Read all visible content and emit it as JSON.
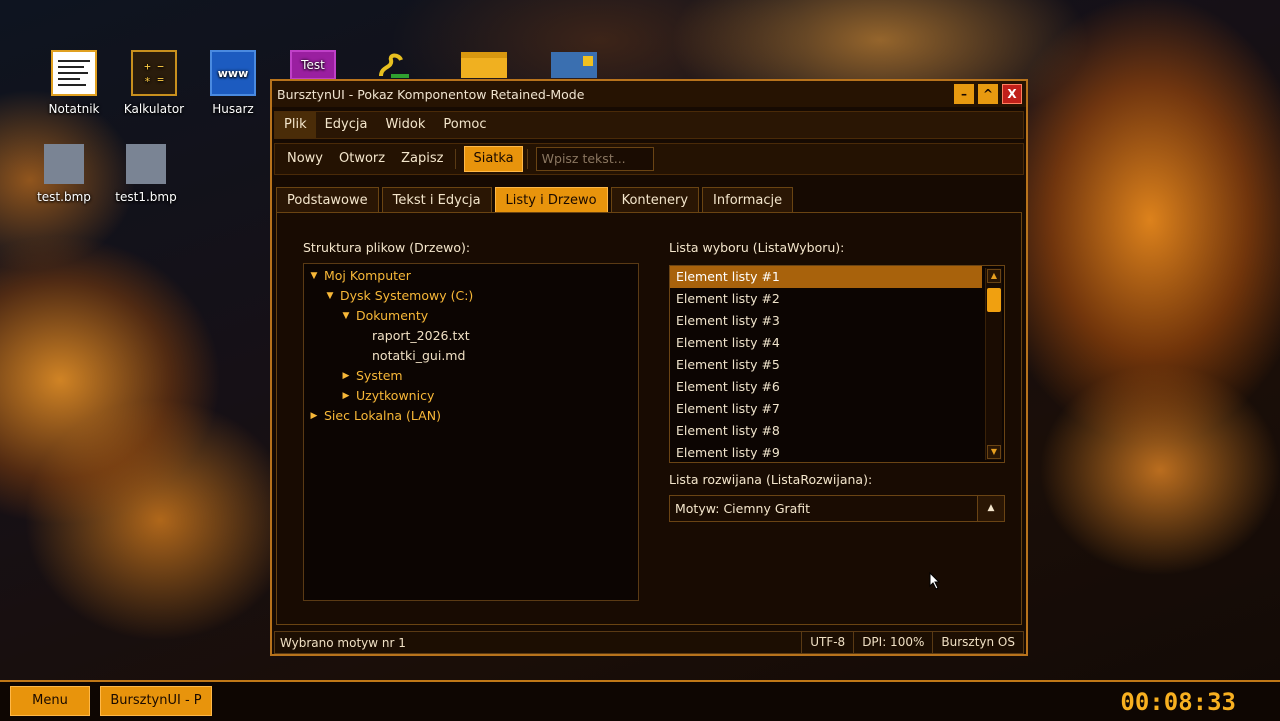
{
  "desktop": {
    "icons": [
      {
        "label": "Notatnik",
        "icon": "notepad-icon"
      },
      {
        "label": "Kalkulator",
        "icon": "calculator-icon",
        "glyph": "+ −\n∗ ="
      },
      {
        "label": "Husarz",
        "icon": "browser-icon",
        "glyph": "www"
      },
      {
        "label": "",
        "icon": "test-app-icon",
        "glyph": "Test"
      },
      {
        "label": "",
        "icon": "snake-icon"
      },
      {
        "label": "",
        "icon": "folder-icon"
      },
      {
        "label": "",
        "icon": "image-icon"
      },
      {
        "label": "test.bmp",
        "icon": "bmp-file-icon"
      },
      {
        "label": "test1.bmp",
        "icon": "bmp-file-icon"
      }
    ]
  },
  "window": {
    "title": "BursztynUI - Pokaz Komponentow Retained-Mode",
    "controls": {
      "minimize": "–",
      "maximize": "^",
      "close": "X"
    },
    "menu": [
      "Plik",
      "Edycja",
      "Widok",
      "Pomoc"
    ],
    "toolbar": {
      "buttons": [
        "Nowy",
        "Otworz",
        "Zapisz"
      ],
      "toggle": "Siatka",
      "input_placeholder": "Wpisz tekst..."
    },
    "tabs": [
      "Podstawowe",
      "Tekst i Edycja",
      "Listy i Drzewo",
      "Kontenery",
      "Informacje"
    ],
    "active_tab": "Listy i Drzewo",
    "tree": {
      "label": "Struktura plikow (Drzewo):",
      "nodes": [
        {
          "text": "Moj Komputer",
          "expanded": true,
          "depth": 0
        },
        {
          "text": "Dysk Systemowy (C:)",
          "expanded": true,
          "depth": 1
        },
        {
          "text": "Dokumenty",
          "expanded": true,
          "depth": 2
        },
        {
          "text": "raport_2026.txt",
          "depth": 3
        },
        {
          "text": "notatki_gui.md",
          "depth": 3
        },
        {
          "text": "System",
          "expanded": false,
          "depth": 2
        },
        {
          "text": "Uzytkownicy",
          "expanded": false,
          "depth": 2
        },
        {
          "text": "Siec Lokalna (LAN)",
          "expanded": false,
          "depth": 0
        }
      ]
    },
    "listbox": {
      "label": "Lista wyboru (ListaWyboru):",
      "items": [
        "Element listy #1",
        "Element listy #2",
        "Element listy #3",
        "Element listy #4",
        "Element listy #5",
        "Element listy #6",
        "Element listy #7",
        "Element listy #8",
        "Element listy #9"
      ],
      "selected": "Element listy #1"
    },
    "dropdown": {
      "label": "Lista rozwijana (ListaRozwijana):",
      "value": "Motyw: Ciemny Grafit"
    },
    "status": {
      "message": "Wybrano motyw nr 1",
      "encoding": "UTF-8",
      "dpi": "DPI: 100%",
      "os": "Bursztyn OS"
    }
  },
  "taskbar": {
    "menu_label": "Menu",
    "app_label": "BursztynUI - P",
    "clock": "00:08:33"
  },
  "colors": {
    "accent": "#e8940c",
    "tree_branch": "#f8b838",
    "selection": "#a8620c"
  }
}
